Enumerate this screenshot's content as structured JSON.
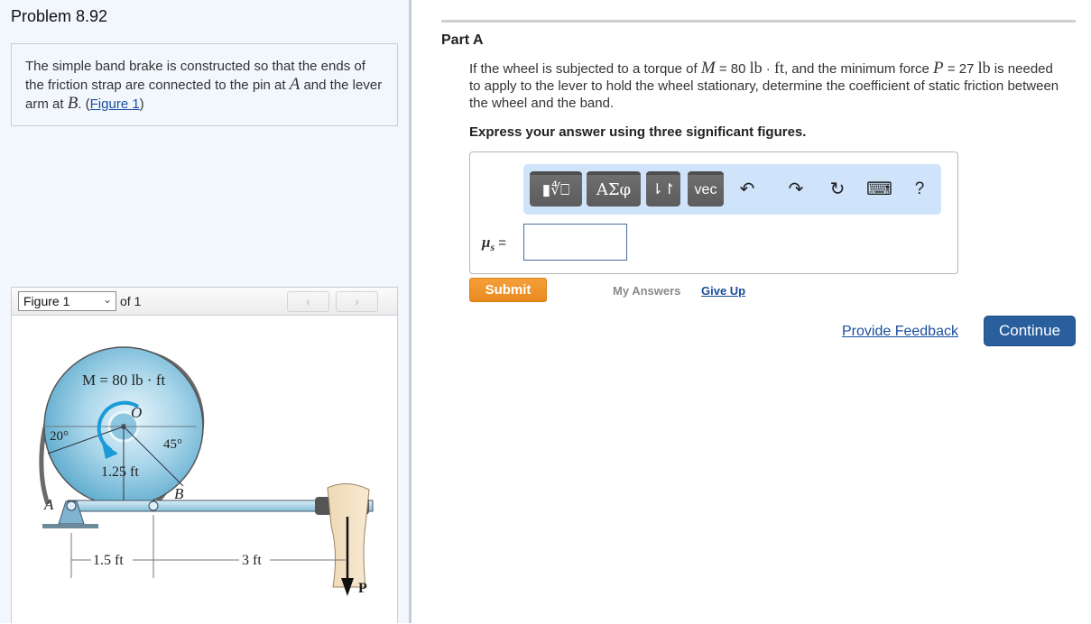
{
  "problem": {
    "title": "Problem 8.92",
    "intro_before_A": "The simple band brake is constructed so that the ends of the friction strap are connected to the pin at ",
    "var_A": "A",
    "intro_mid": " and the lever arm at ",
    "var_B": "B",
    "intro_end_prefix": ". (",
    "figure_link": "Figure 1",
    "intro_end_suffix": ")"
  },
  "figure_viewer": {
    "selected": "Figure 1",
    "of_label": "of 1",
    "prev_icon": "‹",
    "next_icon": "›",
    "figure": {
      "torque_label": "M = 80 lb · ft",
      "center_label": "O",
      "angle_left": "20°",
      "angle_right": "45°",
      "radius_label": "1.25 ft",
      "point_A": "A",
      "point_B": "B",
      "dim_left": "1.5 ft",
      "dim_right": "3 ft",
      "force_label": "P",
      "colors": {
        "wheel": "#9fcfe6",
        "arrow": "#1a9ad6",
        "lever": "#a8d4ea"
      }
    }
  },
  "part": {
    "title": "Part A",
    "question": {
      "t1": "If the wheel is subjected to a torque of ",
      "M": "M",
      "t2": " = 80 ",
      "u1": "lb",
      "t3": " · ",
      "u2": "ft",
      "t4": ", and the minimum force ",
      "P": "P",
      "t5": " = 27 ",
      "u3": "lb",
      "t6": " is needed to apply to the lever to hold the wheel stationary, determine the coefficient of static friction between the wheel and the band."
    },
    "instruction": "Express your answer using three significant figures.",
    "toolbar": {
      "templates": "▮∜⎕",
      "greek": "ΑΣφ",
      "arrows": "⇂↾",
      "vec": "vec",
      "undo_icon": "↶",
      "redo_icon": "↷",
      "reset_icon": "↻",
      "keyboard_icon": "⌨",
      "help": "?"
    },
    "answer_label_var": "μ",
    "answer_label_sub": "s",
    "answer_label_eq": " =",
    "answer_value": "",
    "submit": "Submit",
    "my_answers": "My Answers",
    "give_up": "Give Up"
  },
  "footer": {
    "feedback": "Provide Feedback",
    "continue": "Continue"
  }
}
